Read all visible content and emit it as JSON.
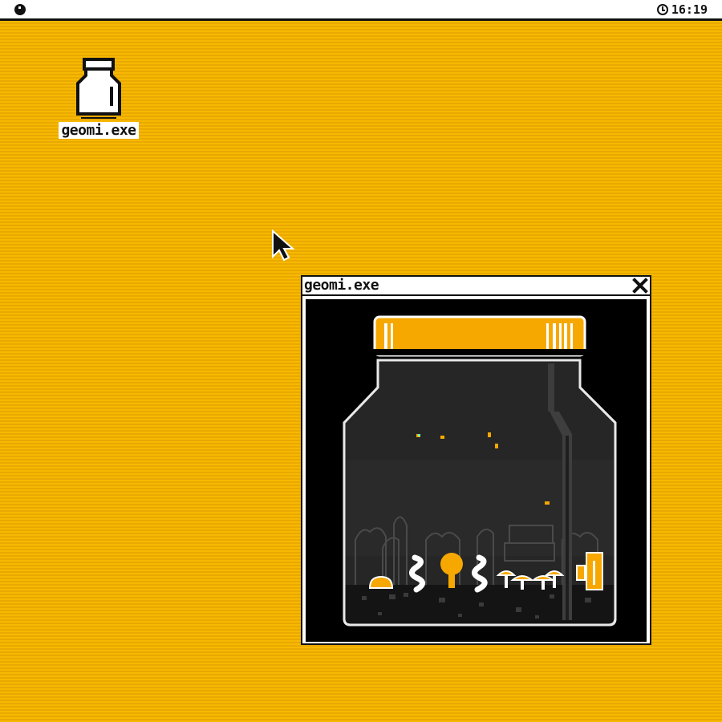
{
  "menubar": {
    "logo_icon": "system-logo-icon",
    "clock_icon": "clock-icon",
    "time": "16:19"
  },
  "desktop": {
    "icon": {
      "label": "geomi.exe",
      "icon": "jar-icon"
    }
  },
  "window": {
    "title": "geomi.exe",
    "close_icon": "close-icon",
    "content": "terrarium-jar-scene"
  },
  "colors": {
    "desktop": "#f4b300",
    "accent": "#f7a800",
    "ink": "#111111"
  }
}
